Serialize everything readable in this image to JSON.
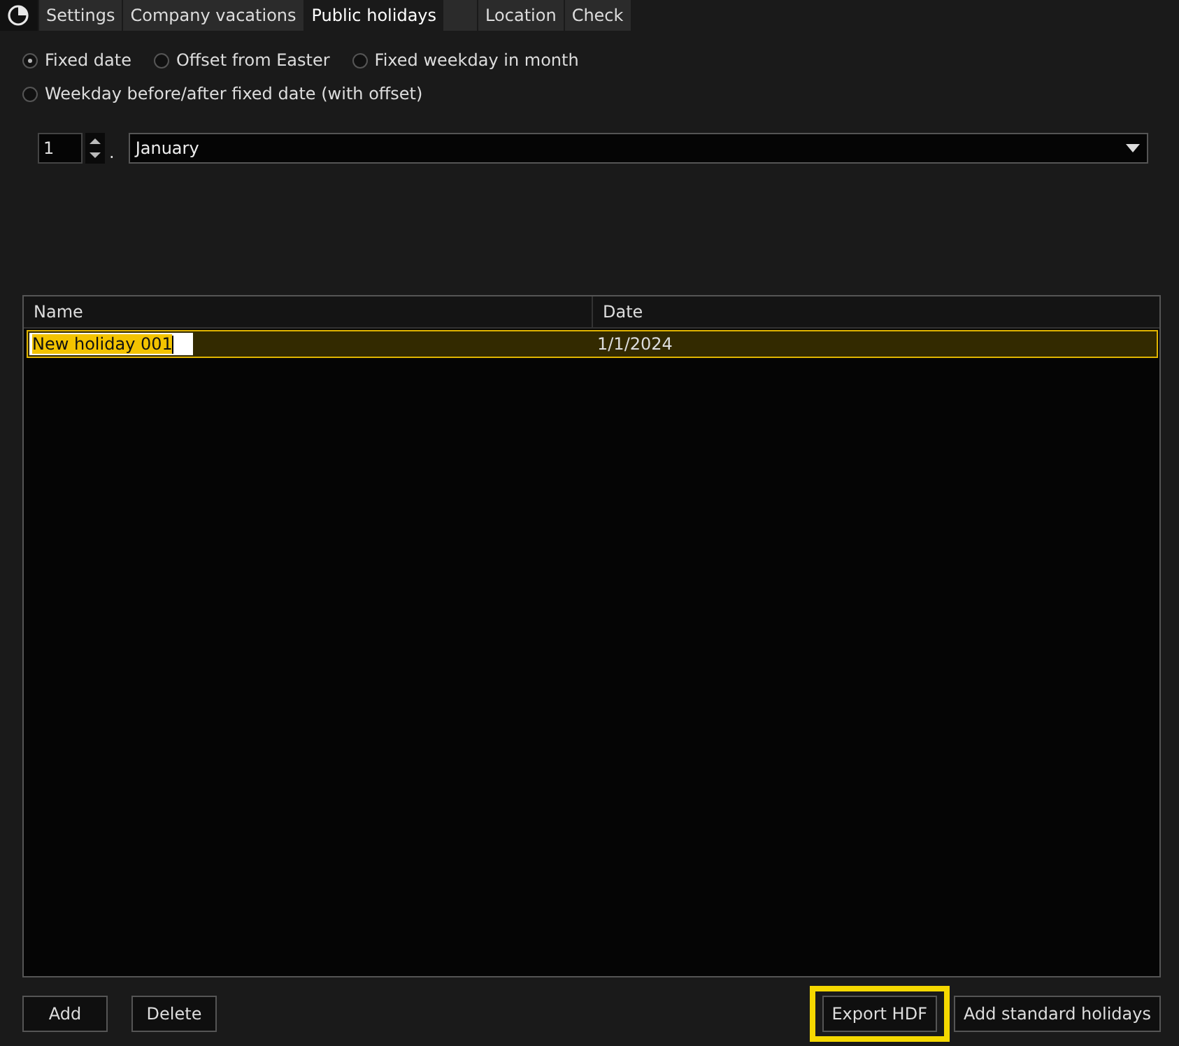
{
  "tabs": [
    {
      "label": "Settings",
      "selected": false
    },
    {
      "label": "Company vacations",
      "selected": false
    },
    {
      "label": "Public holidays",
      "selected": true
    },
    {
      "label": "Location",
      "selected": false
    },
    {
      "label": "Check",
      "selected": false
    }
  ],
  "date_types": [
    {
      "label": "Fixed date",
      "selected": true
    },
    {
      "label": "Offset from Easter",
      "selected": false
    },
    {
      "label": "Fixed weekday in month",
      "selected": false
    },
    {
      "label": "Weekday before/after fixed date (with offset)",
      "selected": false
    }
  ],
  "day": {
    "value": "1",
    "separator": "."
  },
  "month": {
    "value": "January"
  },
  "table": {
    "columns": [
      "Name",
      "Date"
    ],
    "rows": [
      {
        "name": "New holiday 001",
        "date": "1/1/2024",
        "selected": true,
        "editing": true
      }
    ]
  },
  "buttons": [
    {
      "label": "Add",
      "highlighted": false
    },
    {
      "label": "Delete",
      "highlighted": false
    },
    {
      "label": "Export HDF",
      "highlighted": true
    },
    {
      "label": "Add standard holidays",
      "highlighted": false
    }
  ]
}
